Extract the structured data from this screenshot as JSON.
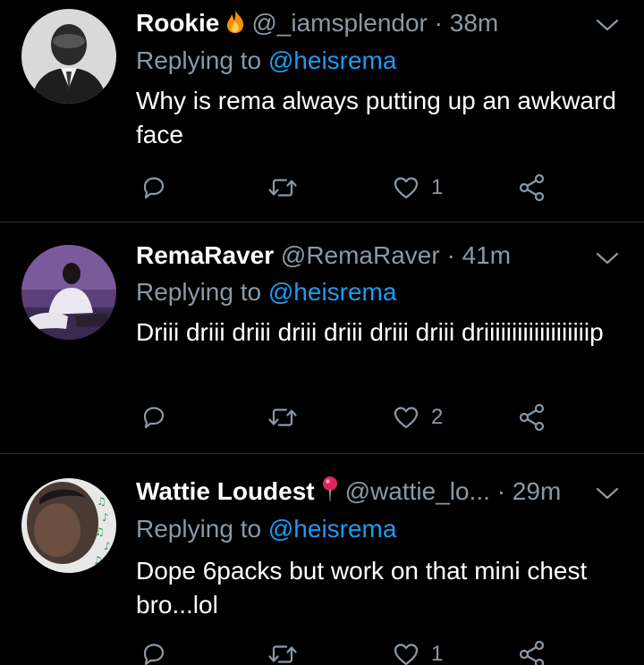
{
  "tweets": [
    {
      "name": "Rookie",
      "name_emoji": "fire-emoji",
      "handle": "@_iamsplendor",
      "separator": "·",
      "time": "38m",
      "replying_prefix": "Replying to",
      "replying_to": "@heisrema",
      "text": "Why is rema always putting up an awkward face",
      "like_count": "1"
    },
    {
      "name": "RemaRaver",
      "name_emoji": "",
      "handle": "@RemaRaver",
      "separator": "·",
      "time": "41m",
      "replying_prefix": "Replying to",
      "replying_to": "@heisrema",
      "text": "Driii driii driii driii driii driii driii driiiiiiiiiiiiiiiiiiip",
      "like_count": "2"
    },
    {
      "name": "Wattie Loudest",
      "name_emoji": "round-pushpin-emoji",
      "handle": "@wattie_lo...",
      "separator": "·",
      "time": "29m",
      "replying_prefix": "Replying to",
      "replying_to": "@heisrema",
      "text": "Dope 6packs but work on that mini chest bro...lol",
      "like_count": "1"
    }
  ],
  "colors": {
    "background": "#000000",
    "text": "#ffffff",
    "muted": "#8b98a5",
    "link": "#1d9bf0",
    "divider": "#2f3336"
  },
  "icons": [
    "reply-icon",
    "retweet-icon",
    "like-icon",
    "share-icon",
    "chevron-down-icon"
  ]
}
